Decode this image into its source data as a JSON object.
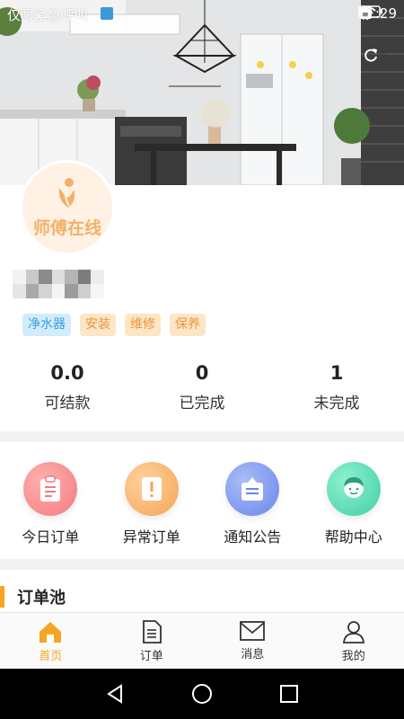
{
  "status_bar": {
    "emergency_text": "仅限紧急呼叫",
    "time": "11:29"
  },
  "profile": {
    "avatar_text": "师傅在线",
    "tags": [
      {
        "label": "净水器",
        "color": "blue"
      },
      {
        "label": "安装",
        "color": "orange"
      },
      {
        "label": "维修",
        "color": "orange"
      },
      {
        "label": "保养",
        "color": "orange"
      }
    ]
  },
  "stats": [
    {
      "value": "0.0",
      "label": "可结款"
    },
    {
      "value": "0",
      "label": "已完成"
    },
    {
      "value": "1",
      "label": "未完成"
    }
  ],
  "quick_menu": [
    {
      "label": "今日订单",
      "icon": "clipboard-icon"
    },
    {
      "label": "异常订单",
      "icon": "exclamation-icon"
    },
    {
      "label": "通知公告",
      "icon": "notice-board-icon"
    },
    {
      "label": "帮助中心",
      "icon": "help-person-icon"
    }
  ],
  "order_pool": {
    "title": "订单池"
  },
  "tabbar": {
    "items": [
      {
        "label": "首页",
        "icon": "home-icon",
        "active": true
      },
      {
        "label": "订单",
        "icon": "document-icon",
        "active": false
      },
      {
        "label": "消息",
        "icon": "mail-icon",
        "active": false
      },
      {
        "label": "我的",
        "icon": "user-icon",
        "active": false
      }
    ]
  },
  "colors": {
    "accent": "#f5a623",
    "tag_blue_text": "#3aa0dc",
    "tag_orange_text": "#e8963a"
  }
}
